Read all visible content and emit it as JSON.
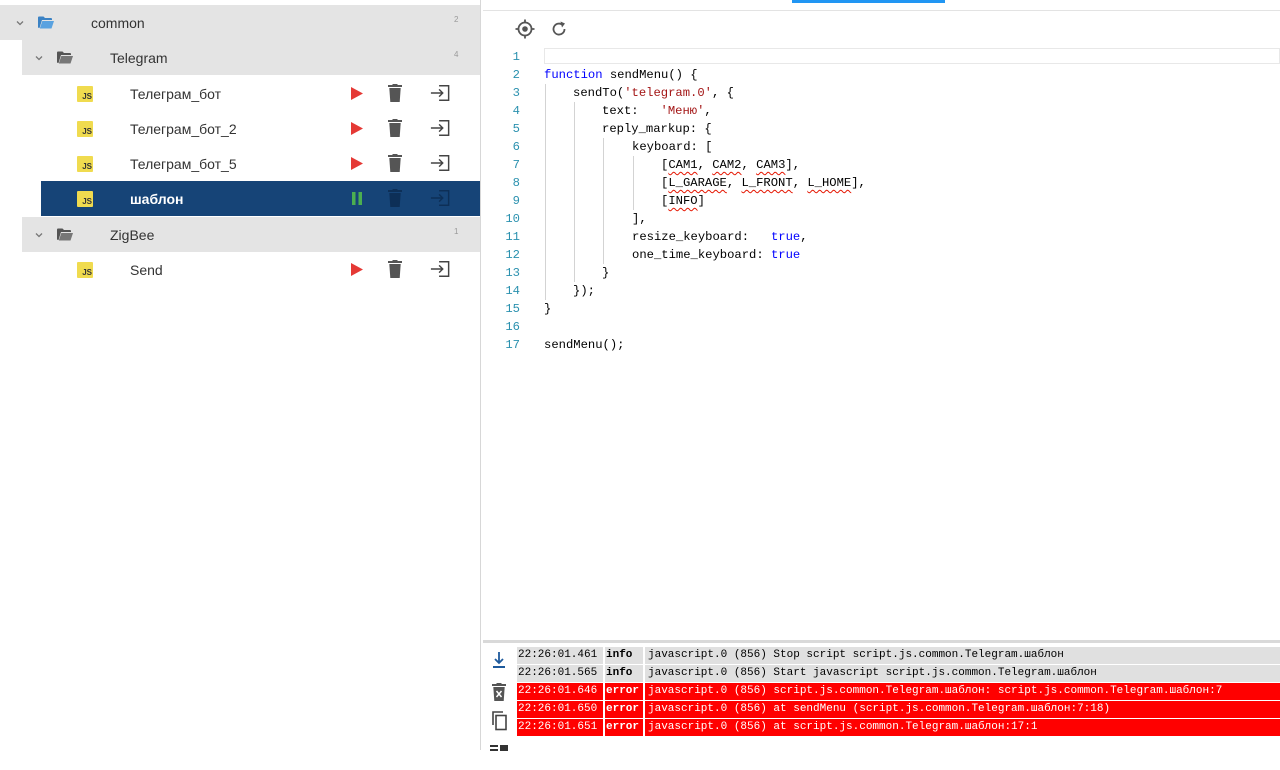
{
  "tree": {
    "root": {
      "name": "common",
      "count": "2"
    },
    "folders": [
      {
        "name": "Telegram",
        "count": "4"
      },
      {
        "name": "ZigBee",
        "count": "1"
      }
    ],
    "scripts": [
      {
        "name": "Телеграм_бот",
        "badge": "JS",
        "state": "stopped"
      },
      {
        "name": "Телеграм_бот_2",
        "badge": "JS",
        "state": "stopped"
      },
      {
        "name": "Телеграм_бот_5",
        "badge": "JS",
        "state": "stopped"
      },
      {
        "name": "шаблон",
        "badge": "JS",
        "state": "running",
        "selected": true
      },
      {
        "name": "Send",
        "badge": "JS",
        "state": "stopped"
      }
    ],
    "colors": {
      "selected_bg": "#164477",
      "run": "#e53935",
      "pause": "#4caf50",
      "folder_bg": "#e4e4e4"
    }
  },
  "editor": {
    "toolbar": {
      "locate_icon": "crosshair-icon",
      "refresh_icon": "refresh-icon"
    },
    "line_numbers": [
      "1",
      "2",
      "3",
      "4",
      "5",
      "6",
      "7",
      "8",
      "9",
      "10",
      "11",
      "12",
      "13",
      "14",
      "15",
      "16",
      "17"
    ],
    "code": {
      "l2_kw": "function",
      "l2_rest": " sendMenu() {",
      "l3_a": "sendTo(",
      "l3_str": "'telegram.0'",
      "l3_b": ", {",
      "l4_a": "text:   ",
      "l4_str": "'Меню'",
      "l4_b": ",",
      "l5": "reply_markup: {",
      "l6": "keyboard: [",
      "l7_a": "[",
      "l7_s1": "CAM1",
      "l7_b": ", ",
      "l7_s2": "CAM2",
      "l7_c": ", ",
      "l7_s3": "CAM3",
      "l7_d": "],",
      "l8_a": "[",
      "l8_s1": "L_GARAGE",
      "l8_b": ", ",
      "l8_s2": "L_FRONT",
      "l8_c": ", ",
      "l8_s3": "L_HOME",
      "l8_d": "],",
      "l9_a": "[",
      "l9_s1": "INFO",
      "l9_d": "]",
      "l10": "],",
      "l11_a": "resize_keyboard:   ",
      "l11_kw": "true",
      "l11_b": ",",
      "l12_a": "one_time_keyboard: ",
      "l12_kw": "true",
      "l13": "}",
      "l14": "});",
      "l15": "}",
      "l17": "sendMenu();"
    }
  },
  "log": {
    "tools": [
      "scroll-down-icon",
      "clear-log-icon",
      "copy-icon",
      "layout-icon"
    ],
    "rows": [
      {
        "time": "22:26:01.461",
        "level": "info",
        "msg": "javascript.0 (856) Stop script script.js.common.Telegram.шаблон"
      },
      {
        "time": "22:26:01.565",
        "level": "info",
        "msg": "javascript.0 (856) Start javascript script.js.common.Telegram.шаблон"
      },
      {
        "time": "22:26:01.646",
        "level": "error",
        "msg": "javascript.0 (856) script.js.common.Telegram.шаблон: script.js.common.Telegram.шаблон:7"
      },
      {
        "time": "22:26:01.650",
        "level": "error",
        "msg": "javascript.0 (856) at sendMenu (script.js.common.Telegram.шаблон:7:18)"
      },
      {
        "time": "22:26:01.651",
        "level": "error",
        "msg": "javascript.0 (856) at script.js.common.Telegram.шаблон:17:1"
      }
    ]
  }
}
